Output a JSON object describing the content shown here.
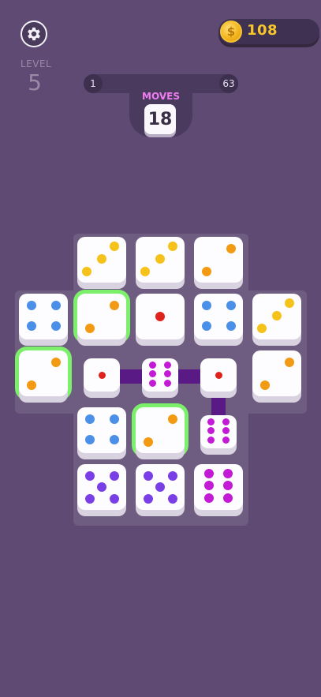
{
  "hud": {
    "settings_icon": "gear-icon",
    "coins": {
      "icon": "coin-icon",
      "symbol": "$",
      "value": "108",
      "color": "#f7c62b"
    },
    "level": {
      "label": "LEVEL",
      "value": "5"
    },
    "progress": {
      "start": "1",
      "end": "63"
    },
    "moves": {
      "label": "MOVES",
      "value": "18",
      "label_color": "#f07cf2"
    }
  },
  "colors": {
    "background": "#5e4a72",
    "board": "#6f5d81",
    "glow": "#7cf06a",
    "connector": "#5a1a85",
    "pip_values": {
      "1": "#e0221c",
      "2": "#f29a12",
      "3": "#f5c21a",
      "4": "#4a8fe8",
      "5": "#7a3ee6",
      "6": "#c31ad6"
    }
  },
  "board": {
    "dice": [
      {
        "row": 0,
        "col": 1,
        "value": 3
      },
      {
        "row": 0,
        "col": 2,
        "value": 3
      },
      {
        "row": 0,
        "col": 3,
        "value": 2
      },
      {
        "row": 1,
        "col": 0,
        "value": 4
      },
      {
        "row": 1,
        "col": 1,
        "value": 2,
        "highlighted": true
      },
      {
        "row": 1,
        "col": 2,
        "value": 1
      },
      {
        "row": 1,
        "col": 3,
        "value": 4
      },
      {
        "row": 1,
        "col": 4,
        "value": 3
      },
      {
        "row": 2,
        "col": 0,
        "value": 2,
        "highlighted": true
      },
      {
        "row": 2,
        "col": 1,
        "value": 1,
        "small": true
      },
      {
        "row": 2,
        "col": 2,
        "value": 6,
        "small": true
      },
      {
        "row": 2,
        "col": 3,
        "value": 1,
        "small": true
      },
      {
        "row": 2,
        "col": 4,
        "value": 2
      },
      {
        "row": 3,
        "col": 1,
        "value": 4
      },
      {
        "row": 3,
        "col": 2,
        "value": 2,
        "highlighted": true
      },
      {
        "row": 3,
        "col": 3,
        "value": 6,
        "small": true
      },
      {
        "row": 4,
        "col": 1,
        "value": 5
      },
      {
        "row": 4,
        "col": 2,
        "value": 5
      },
      {
        "row": 4,
        "col": 3,
        "value": 6
      }
    ],
    "links": [
      {
        "from": [
          2,
          1
        ],
        "to": [
          2,
          2
        ]
      },
      {
        "from": [
          2,
          2
        ],
        "to": [
          2,
          3
        ]
      },
      {
        "from": [
          2,
          3
        ],
        "to": [
          3,
          3
        ]
      }
    ]
  }
}
